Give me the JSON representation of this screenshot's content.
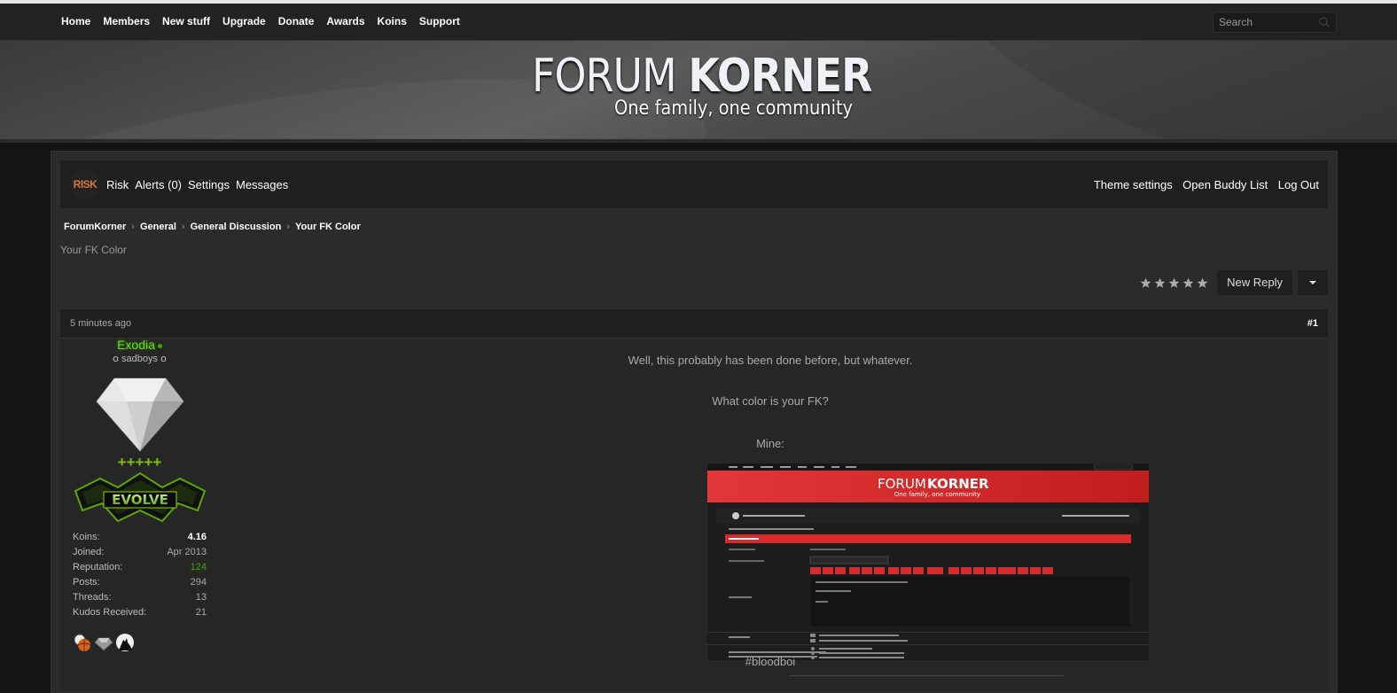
{
  "nav": {
    "items": [
      "Home",
      "Members",
      "New stuff",
      "Upgrade",
      "Donate",
      "Awards",
      "Koins",
      "Support"
    ],
    "search_placeholder": "Search"
  },
  "banner": {
    "logo_light": "FORUM ",
    "logo_bold": "KORNER",
    "tagline": "One family, one community"
  },
  "userbar": {
    "avatar_text": "RISK",
    "username": "Risk",
    "alerts": "Alerts (0)",
    "settings": "Settings",
    "messages": "Messages",
    "theme_settings": "Theme settings",
    "buddy_list": "Open Buddy List",
    "logout": "Log Out"
  },
  "breadcrumb": [
    "ForumKorner",
    "General",
    "General Discussion",
    "Your FK Color"
  ],
  "thread": {
    "title": "Your FK Color",
    "new_reply": "New Reply",
    "rating_stars": 5
  },
  "post": {
    "time": "5 minutes ago",
    "number": "#1",
    "author": {
      "name": "Exodia",
      "title": "໐ sadboys ໐",
      "pluses": "+++++",
      "rank_banner": "EVOLVE",
      "stats": [
        {
          "label": "Koins:",
          "value": "4.16",
          "style": "bold"
        },
        {
          "label": "Joined:",
          "value": "Apr 2013",
          "style": ""
        },
        {
          "label": "Reputation:",
          "value": "124",
          "style": "green"
        },
        {
          "label": "Posts:",
          "value": "294",
          "style": ""
        },
        {
          "label": "Threads:",
          "value": "13",
          "style": ""
        },
        {
          "label": "Kudos Received:",
          "value": "21",
          "style": ""
        }
      ]
    },
    "body": {
      "line1": "Well, this probably has been done before, but whatever.",
      "line2": "What color is your FK?",
      "line3": "Mine:",
      "hashtag": "#bloodboi"
    },
    "screenshot": {
      "logo_light": "FORUM ",
      "logo_bold": "KORNER",
      "tagline": "One family, one community",
      "accent": "#d82a2a"
    }
  },
  "colors": {
    "accent_green": "#66dd22",
    "reputation_green": "#3fa600",
    "red_theme": "#d82a2a"
  }
}
